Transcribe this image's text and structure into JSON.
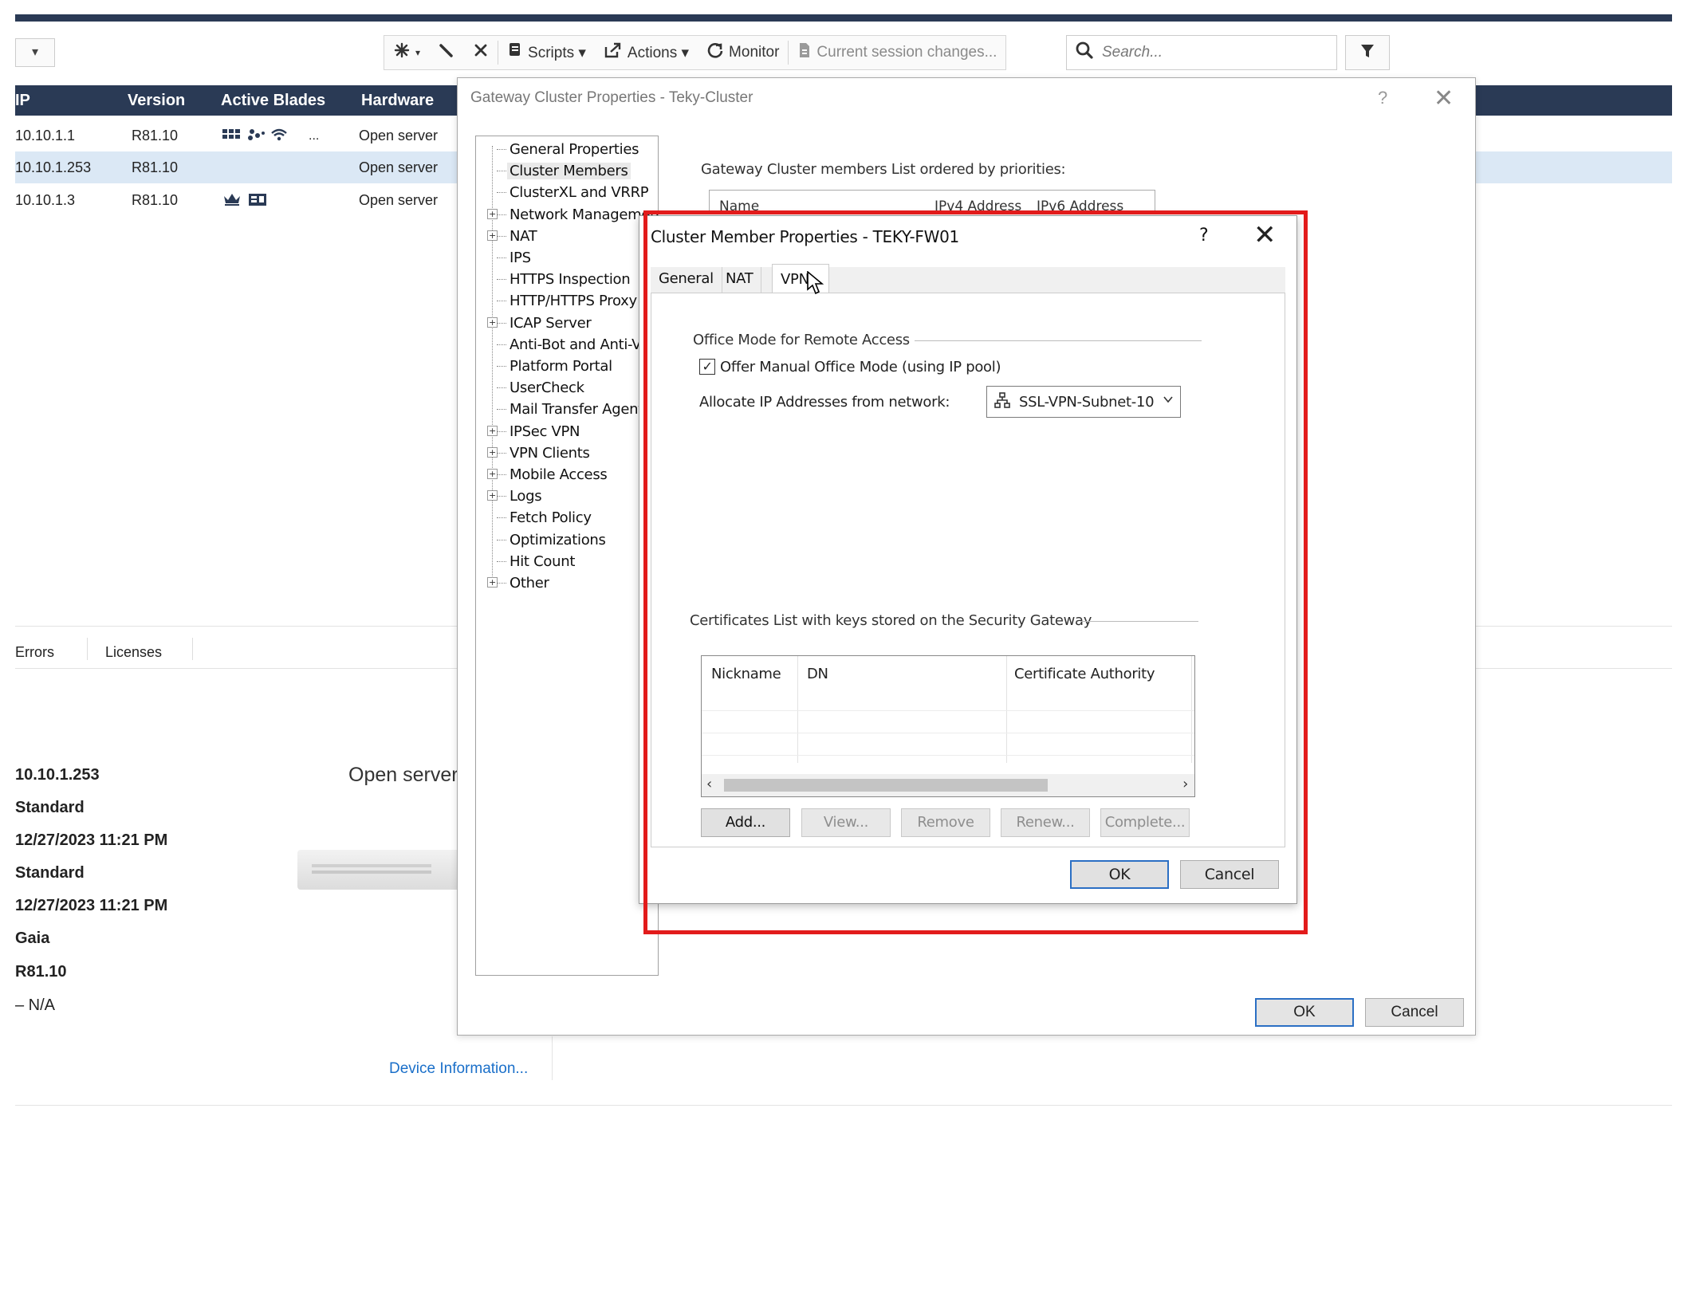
{
  "toolbar": {
    "dropdown_arrow": "▾",
    "new_icon": "new-icon",
    "edit_icon": "edit-icon",
    "delete_icon": "delete-icon",
    "scripts_label": "Scripts ▾",
    "actions_label": "Actions ▾",
    "monitor_label": "Monitor",
    "session_changes_label": "Current session changes...",
    "search_placeholder": "Search..."
  },
  "table": {
    "headers": [
      "IP",
      "Version",
      "Active Blades",
      "Hardware"
    ],
    "rows": [
      {
        "ip": "10.10.1.1",
        "version": "R81.10",
        "hardware": "Open server"
      },
      {
        "ip": "10.10.1.253",
        "version": "R81.10",
        "hardware": "Open server"
      },
      {
        "ip": "10.10.1.3",
        "version": "R81.10",
        "hardware": "Open server"
      }
    ],
    "blades_ellipsis": "..."
  },
  "bottom_tabs": [
    "Errors",
    "Licenses"
  ],
  "details": {
    "ip": "10.10.1.253",
    "hardware": "Open server",
    "lines": [
      "Standard",
      "12/27/2023 11:21 PM",
      "Standard",
      "12/27/2023 11:21 PM",
      "Gaia",
      "R81.10",
      "– N/A"
    ],
    "device_link": "Device Information..."
  },
  "gateway_window": {
    "title": "Gateway Cluster Properties - Teky-Cluster",
    "help": "?",
    "close": "✕",
    "description": "Gateway Cluster members List ordered by priorities:",
    "members_table_headers": [
      "Name",
      "IPv4 Address",
      "IPv6 Address"
    ],
    "tree": [
      {
        "label": "General Properties",
        "expandable": false
      },
      {
        "label": "Cluster Members",
        "expandable": false,
        "selected": true
      },
      {
        "label": "ClusterXL and VRRP",
        "expandable": false
      },
      {
        "label": "Network Management",
        "expandable": true
      },
      {
        "label": "NAT",
        "expandable": true
      },
      {
        "label": "IPS",
        "expandable": false
      },
      {
        "label": "HTTPS Inspection",
        "expandable": false
      },
      {
        "label": "HTTP/HTTPS Proxy",
        "expandable": false
      },
      {
        "label": "ICAP Server",
        "expandable": true
      },
      {
        "label": "Anti-Bot and Anti-Virus",
        "expandable": false
      },
      {
        "label": "Platform Portal",
        "expandable": false
      },
      {
        "label": "UserCheck",
        "expandable": false
      },
      {
        "label": "Mail Transfer Agent",
        "expandable": false
      },
      {
        "label": "IPSec VPN",
        "expandable": true
      },
      {
        "label": "VPN Clients",
        "expandable": true
      },
      {
        "label": "Mobile Access",
        "expandable": true
      },
      {
        "label": "Logs",
        "expandable": true
      },
      {
        "label": "Fetch Policy",
        "expandable": false
      },
      {
        "label": "Optimizations",
        "expandable": false
      },
      {
        "label": "Hit Count",
        "expandable": false
      },
      {
        "label": "Other",
        "expandable": true
      }
    ],
    "ok_label": "OK",
    "cancel_label": "Cancel"
  },
  "member_dialog": {
    "title": "Cluster Member Properties - TEKY-FW01",
    "help": "?",
    "close": "✕",
    "tabs": [
      {
        "label": "General",
        "active": false
      },
      {
        "label": "NAT",
        "active": false
      },
      {
        "label": "VPN",
        "active": true
      }
    ],
    "office_mode_group": "Office Mode for Remote Access",
    "offer_manual_label": "Offer Manual Office Mode (using IP pool)",
    "offer_manual_checked": true,
    "allocate_label": "Allocate IP Addresses from network:",
    "network_value": "SSL-VPN-Subnet-10",
    "network_icon": "network-icon",
    "certs_group": "Certificates List with keys stored on the Security Gateway",
    "cert_headers": [
      "Nickname",
      "DN",
      "Certificate Authority"
    ],
    "cert_buttons": [
      {
        "label": "Add...",
        "enabled": true
      },
      {
        "label": "View...",
        "enabled": false
      },
      {
        "label": "Remove",
        "enabled": false
      },
      {
        "label": "Renew...",
        "enabled": false
      },
      {
        "label": "Complete...",
        "enabled": false
      }
    ],
    "ok_label": "OK",
    "cancel_label": "Cancel"
  },
  "colors": {
    "header_bar": "#2a3a55",
    "selected_row": "#dbe8f5",
    "highlight_box": "#e21b1b",
    "default_button_border": "#2b6fc4",
    "link": "#1a6fc9"
  }
}
